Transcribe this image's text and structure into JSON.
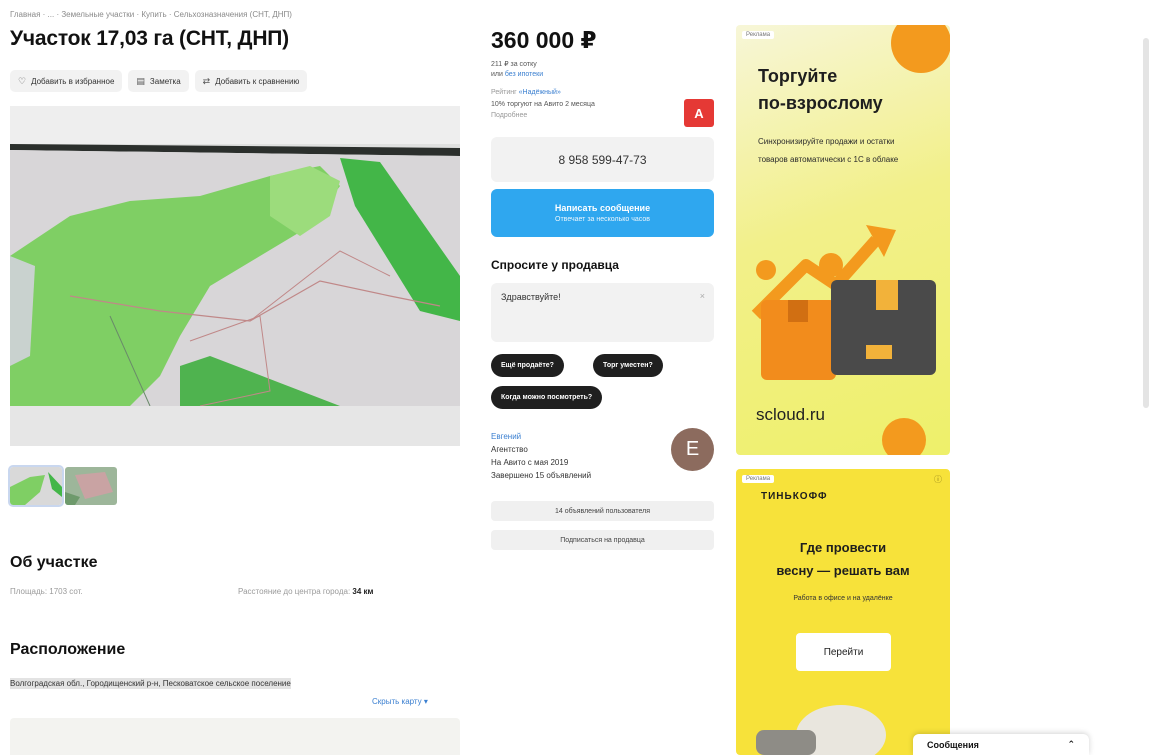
{
  "breadcrumb": "Главная · ... · Земельные участки · Купить · Сельхозназначения (СНТ, ДНП)",
  "title": "Участок 17,03 га (СНТ, ДНП)",
  "actions": [
    {
      "icon": "heart-icon",
      "glyph": "♡",
      "label": "Добавить в избранное"
    },
    {
      "icon": "note-icon",
      "glyph": "▤",
      "label": "Заметка"
    },
    {
      "icon": "compare-icon",
      "glyph": "⇄",
      "label": "Добавить к сравнению"
    }
  ],
  "about": {
    "title": "Об участке",
    "area_label": "Площадь:",
    "area_value": "1703 сот.",
    "distance_label": "Расстояние до центра города:",
    "distance_value": "34 км"
  },
  "location": {
    "title": "Расположение",
    "address": "Волгоградская обл., Городищенский р-н, Песковатское сельское поселение",
    "map_link": "Скрыть карту ▾"
  },
  "price": {
    "value": "360 000 ₽",
    "per_unit": "211 ₽ за сотку",
    "mortgage_prefix": "или",
    "mortgage_link": "без ипотеки",
    "rating_label": "Рейтинг",
    "rating_link": "«Надёжный»",
    "note": "10% торгуют на Авито 2 месяца",
    "note_sub": "Подробнее"
  },
  "badge": {
    "label": "А"
  },
  "contact": {
    "phone": "8 958 599-47-73",
    "message_button": "Написать сообщение",
    "message_sub": "Отвечает за несколько часов"
  },
  "ask": {
    "title": "Спросите у продавца",
    "placeholder": "Здравствуйте!",
    "close": "×",
    "chips": [
      "Ещё продаёте?",
      "Торг уместен?",
      "Когда можно посмотреть?"
    ]
  },
  "seller": {
    "name": "Евгений",
    "type": "Агентство",
    "since": "На Авито с мая 2019",
    "completed": "Завершено 15 объявлений",
    "avatar_letter": "Е",
    "listings_button": "14 объявлений пользователя",
    "subscribe_button": "Подписаться на продавца"
  },
  "ad1": {
    "tag": "Реклама",
    "headline": [
      "Торгуйте",
      "по-взрослому"
    ],
    "body": "Синхронизируйте продажи и остатки товаров автоматически с 1С в облаке",
    "brand": "scloud.ru",
    "accent": "#f39a1e"
  },
  "ad2": {
    "tag": "Реклама",
    "brand": "ТИНЬКОФФ",
    "headline": [
      "Где провести",
      "весну — решать вам"
    ],
    "sub": "Работа в офисе и на удалёнке",
    "cta": "Перейти",
    "accent": "#f7e23a"
  },
  "messenger": {
    "label": "Сообщения",
    "chevron": "⌃"
  },
  "colors": {
    "primary": "#2fa7ef",
    "red": "#e53935",
    "chip": "#1f1f1f"
  }
}
